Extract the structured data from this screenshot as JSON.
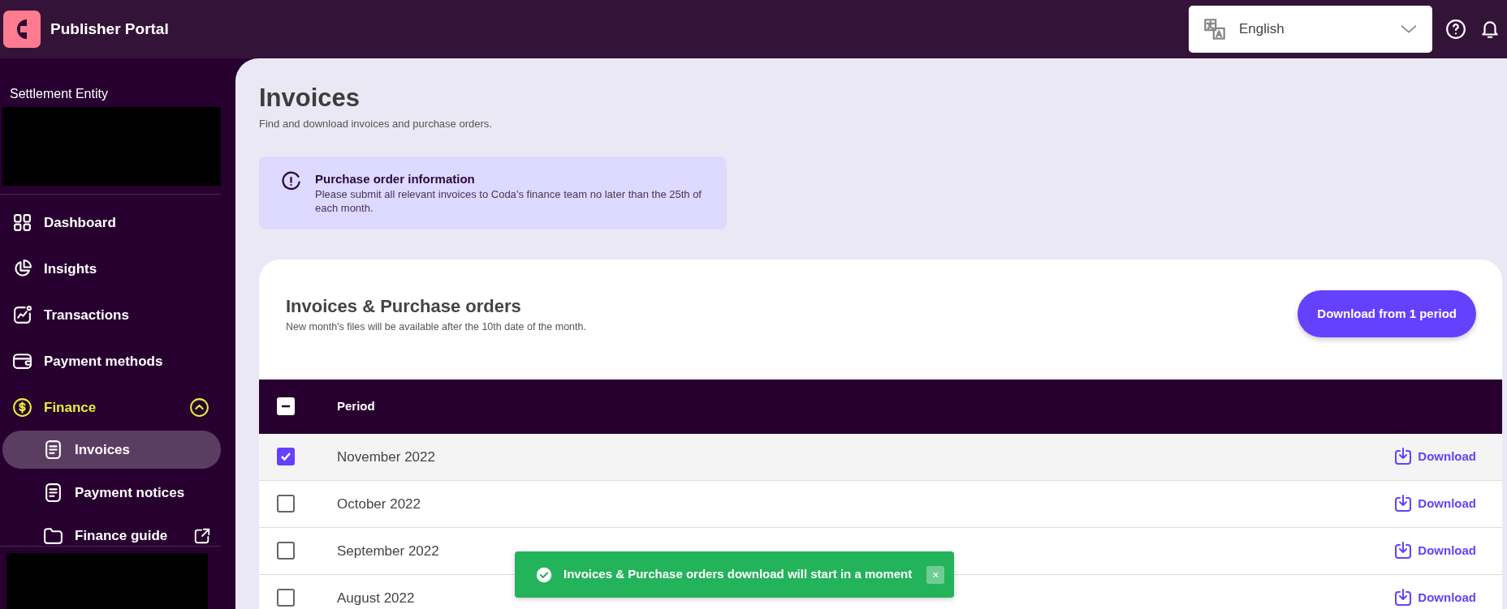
{
  "header": {
    "title": "Publisher Portal",
    "language": {
      "value": "English"
    }
  },
  "sidebar": {
    "entity_label": "Settlement Entity",
    "items": [
      {
        "label": "Dashboard",
        "selected": false
      },
      {
        "label": "Insights",
        "selected": false
      },
      {
        "label": "Transactions",
        "selected": false
      },
      {
        "label": "Payment methods",
        "selected": false
      },
      {
        "label": "Finance",
        "selected": false,
        "expanded": true,
        "children": [
          {
            "label": "Invoices",
            "selected": true,
            "external": false
          },
          {
            "label": "Payment notices",
            "selected": false,
            "external": false
          },
          {
            "label": "Finance guide",
            "selected": false,
            "external": true
          }
        ]
      }
    ]
  },
  "page": {
    "title": "Invoices",
    "subtitle": "Find and download invoices and purchase orders.",
    "alert": {
      "title": "Purchase order information",
      "text": "Please submit all relevant invoices to Coda’s finance team no later than the 25th of each month."
    },
    "card": {
      "title": "Invoices & Purchase orders",
      "subtitle": "New month's files will be available after the 10th date of the month.",
      "button": "Download from 1 period"
    },
    "table": {
      "select_all_indeterminate": true,
      "columns": [
        "Period"
      ],
      "rows": [
        {
          "period": "November 2022",
          "selected": true,
          "action": "Download"
        },
        {
          "period": "October 2022",
          "selected": false,
          "action": "Download"
        },
        {
          "period": "September 2022",
          "selected": false,
          "action": "Download"
        },
        {
          "period": "August 2022",
          "selected": false,
          "action": "Download"
        }
      ]
    },
    "toast": {
      "text": "Invoices & Purchase orders download will start in a moment",
      "close": "×"
    }
  }
}
